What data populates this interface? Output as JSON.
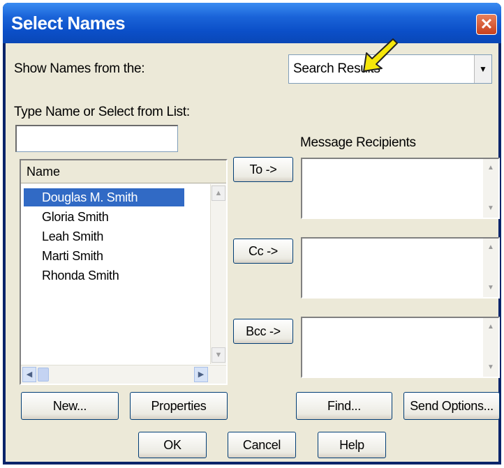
{
  "window": {
    "title": "Select Names"
  },
  "show_names": {
    "label": "Show Names from the:",
    "selected": "Search Results"
  },
  "type_name": {
    "label": "Type Name or Select from List:",
    "value": ""
  },
  "name_list": {
    "header": "Name",
    "items": [
      "Douglas M. Smith",
      "Gloria Smith",
      "Leah Smith",
      "Marti Smith",
      "Rhonda Smith"
    ],
    "selected_index": 0
  },
  "recipients": {
    "label": "Message Recipients",
    "to_button": "To ->",
    "cc_button": "Cc ->",
    "bcc_button": "Bcc ->"
  },
  "buttons": {
    "new": "New...",
    "properties": "Properties",
    "find": "Find...",
    "send_options": "Send Options...",
    "ok": "OK",
    "cancel": "Cancel",
    "help": "Help"
  },
  "colors": {
    "titlebar": "#0b4fc8",
    "selection": "#316ac5",
    "dialog_bg": "#ece9d8",
    "annotation_arrow": "#f5e60a"
  },
  "icons": {
    "close": "close-icon",
    "annotation": "yellow-arrow-icon"
  }
}
